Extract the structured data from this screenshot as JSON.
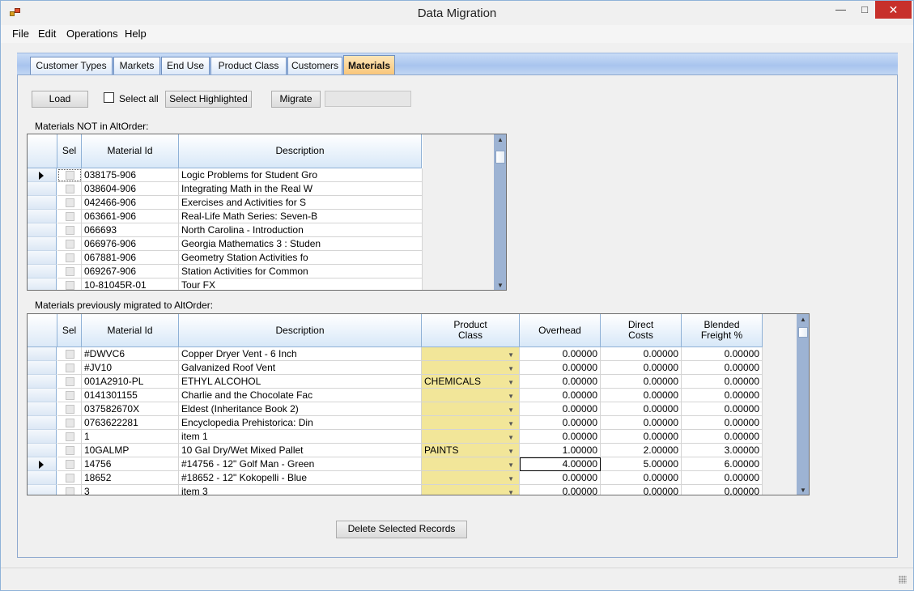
{
  "window": {
    "title": "Data Migration",
    "min_glyph": "—",
    "max_glyph": "□",
    "close_glyph": "✕"
  },
  "menu": [
    "File",
    "Edit",
    "Operations",
    "Help"
  ],
  "tabs": [
    "Customer Types",
    "Markets",
    "End Use",
    "Product Class",
    "Customers",
    "Materials"
  ],
  "active_tab": "Materials",
  "toolbar": {
    "load_label": "Load",
    "select_all_label": "Select all",
    "select_all_checked": false,
    "select_highlighted_label": "Select Highlighted",
    "migrate_label": "Migrate",
    "migrate_field_value": ""
  },
  "grid1": {
    "caption": "Materials NOT in AltOrder:",
    "columns": [
      "Sel",
      "Material Id",
      "Description"
    ],
    "current_row": 0,
    "rows": [
      {
        "material_id": "038175-906",
        "description": "Logic Problems for Student Gro"
      },
      {
        "material_id": "038604-906",
        "description": "Integrating Math in the Real W"
      },
      {
        "material_id": "042466-906",
        "description": "Exercises and Activities for S"
      },
      {
        "material_id": "063661-906",
        "description": "Real-Life Math Series: Seven-B"
      },
      {
        "material_id": "066693",
        "description": "North Carolina - Introduction"
      },
      {
        "material_id": "066976-906",
        "description": "Georgia Mathematics 3 : Studen"
      },
      {
        "material_id": "067881-906",
        "description": "Geometry Station Activities fo"
      },
      {
        "material_id": "069267-906",
        "description": "Station Activities for Common"
      },
      {
        "material_id": "10-81045R-01",
        "description": "Tour FX"
      }
    ]
  },
  "grid2": {
    "caption": "Materials previously migrated to AltOrder:",
    "columns": [
      "Sel",
      "Material Id",
      "Description",
      "Product Class",
      "Overhead",
      "Direct Costs",
      "Blended Freight %"
    ],
    "current_row": 8,
    "rows": [
      {
        "material_id": "#DWVC6",
        "description": "Copper Dryer Vent - 6 Inch",
        "product_class": "",
        "overhead": "0.00000",
        "direct_costs": "0.00000",
        "blended_freight": "0.00000"
      },
      {
        "material_id": "#JV10",
        "description": "Galvanized Roof Vent",
        "product_class": "",
        "overhead": "0.00000",
        "direct_costs": "0.00000",
        "blended_freight": "0.00000"
      },
      {
        "material_id": "001A2910-PL",
        "description": "ETHYL ALCOHOL",
        "product_class": "CHEMICALS",
        "overhead": "0.00000",
        "direct_costs": "0.00000",
        "blended_freight": "0.00000"
      },
      {
        "material_id": "0141301155",
        "description": "Charlie and the Chocolate Fac",
        "product_class": "",
        "overhead": "0.00000",
        "direct_costs": "0.00000",
        "blended_freight": "0.00000"
      },
      {
        "material_id": "037582670X",
        "description": "Eldest (Inheritance Book 2)",
        "product_class": "",
        "overhead": "0.00000",
        "direct_costs": "0.00000",
        "blended_freight": "0.00000"
      },
      {
        "material_id": "0763622281",
        "description": "Encyclopedia Prehistorica: Din",
        "product_class": "",
        "overhead": "0.00000",
        "direct_costs": "0.00000",
        "blended_freight": "0.00000"
      },
      {
        "material_id": "1",
        "description": "item 1",
        "product_class": "",
        "overhead": "0.00000",
        "direct_costs": "0.00000",
        "blended_freight": "0.00000"
      },
      {
        "material_id": "10GALMP",
        "description": "10 Gal Dry/Wet Mixed Pallet",
        "product_class": "PAINTS",
        "overhead": "1.00000",
        "direct_costs": "2.00000",
        "blended_freight": "3.00000"
      },
      {
        "material_id": "14756",
        "description": "#14756 - 12\" Golf Man - Green",
        "product_class": "",
        "overhead": "4.00000",
        "direct_costs": "5.00000",
        "blended_freight": "6.00000",
        "editing_overhead": true
      },
      {
        "material_id": "18652",
        "description": "#18652 - 12\" Kokopelli - Blue",
        "product_class": "",
        "overhead": "0.00000",
        "direct_costs": "0.00000",
        "blended_freight": "0.00000"
      },
      {
        "material_id": "3",
        "description": "item 3",
        "product_class": "",
        "overhead": "0.00000",
        "direct_costs": "0.00000",
        "blended_freight": "0.00000"
      }
    ]
  },
  "delete_button_label": "Delete Selected Records",
  "colors": {
    "accent": "#f9c67a",
    "combo_bg": "#f2e699",
    "close_red": "#c7302b"
  }
}
